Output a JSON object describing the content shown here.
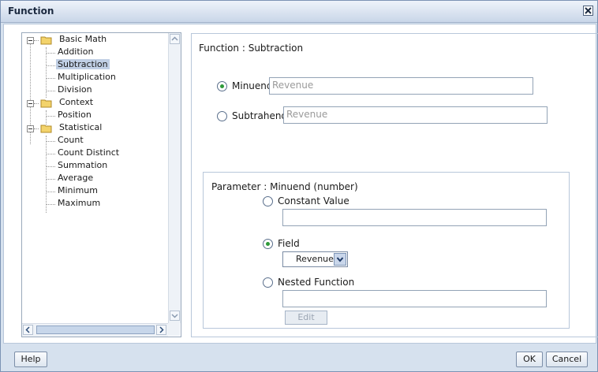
{
  "window": {
    "title": "Function",
    "close_icon": "close-icon"
  },
  "tree": {
    "groups": [
      {
        "label": "Basic Math",
        "children": [
          "Addition",
          "Subtraction",
          "Multiplication",
          "Division"
        ]
      },
      {
        "label": "Context",
        "children": [
          "Position"
        ]
      },
      {
        "label": "Statistical",
        "children": [
          "Count",
          "Count Distinct",
          "Summation",
          "Average",
          "Minimum",
          "Maximum"
        ]
      }
    ],
    "selected": "Subtraction"
  },
  "main": {
    "heading": "Function : Subtraction",
    "minuend": {
      "label": "Minuend",
      "value": "Revenue",
      "selected": true
    },
    "subtrahend": {
      "label": "Subtrahend",
      "value": "Revenue",
      "selected": false
    },
    "parameter": {
      "heading": "Parameter : Minuend (number)",
      "constant_label": "Constant Value",
      "constant_value": "",
      "field_label": "Field",
      "field_value": "Revenue",
      "nested_label": "Nested Function",
      "nested_value": "",
      "edit_label": "Edit",
      "selected_option": "Field"
    }
  },
  "footer": {
    "help_label": "Help",
    "ok_label": "OK",
    "cancel_label": "Cancel"
  },
  "colors": {
    "accent": "#2e9a3a",
    "titlebar": "#c9d6e8",
    "selection": "#c0cfe4"
  }
}
